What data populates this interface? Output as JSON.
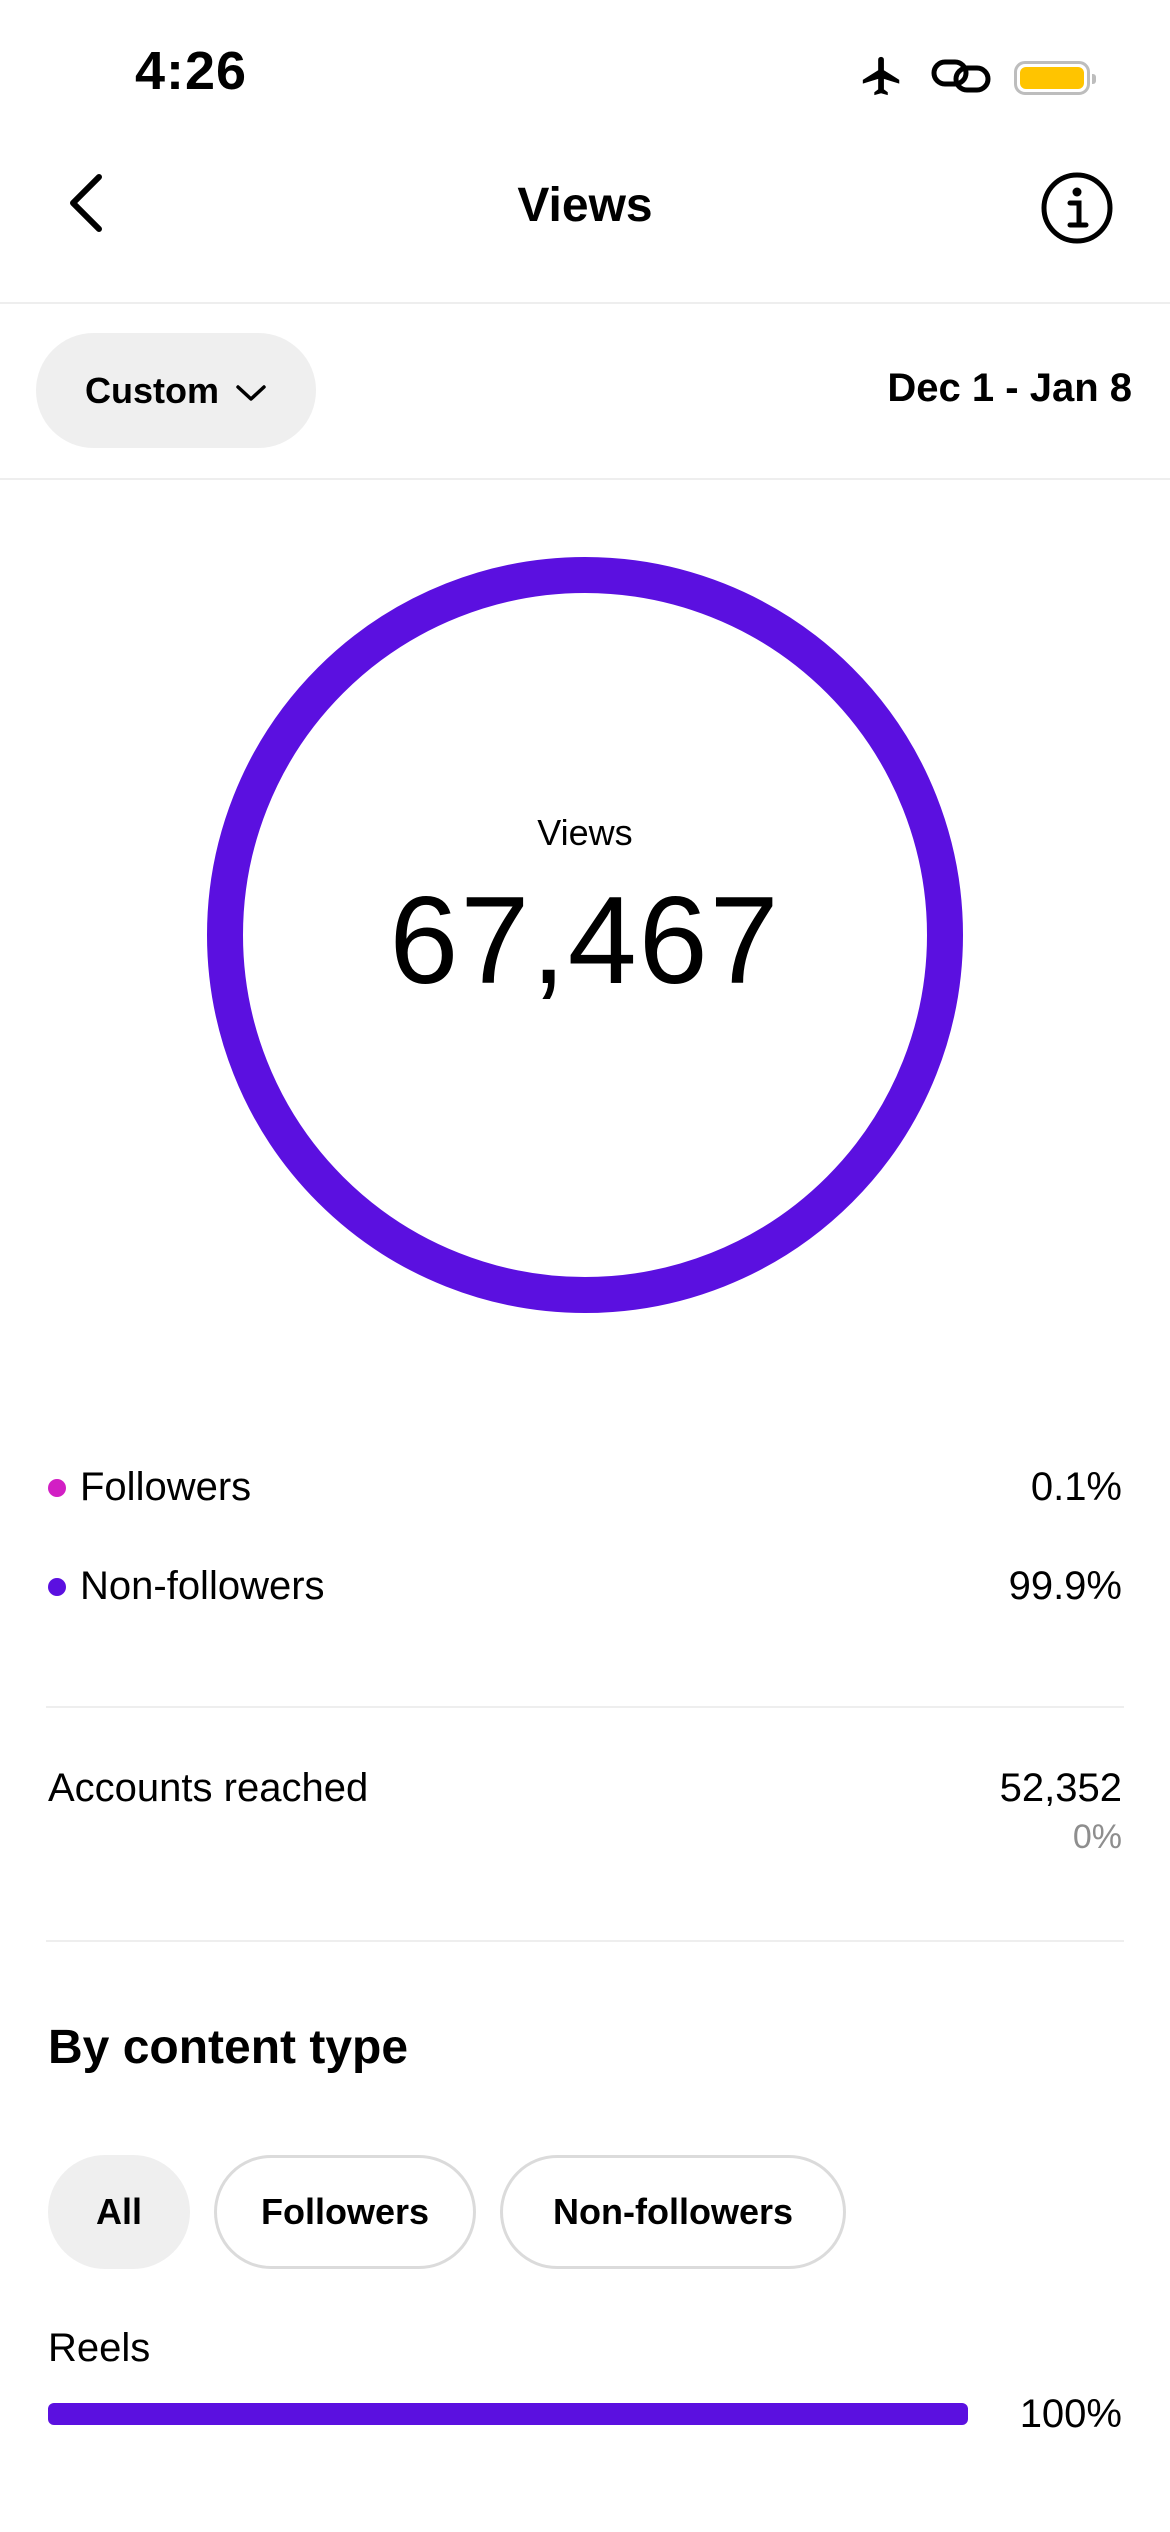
{
  "status_bar": {
    "time": "4:26",
    "icons": [
      "airplane-icon",
      "link-icon",
      "battery-icon"
    ],
    "battery_color": "#ffc400"
  },
  "nav": {
    "title": "Views",
    "back_icon": "chevron-left-icon",
    "info_icon": "info-icon"
  },
  "filter": {
    "range_label": "Custom",
    "date_range": "Dec 1 - Jan 8"
  },
  "summary": {
    "label": "Views",
    "value": "67,467",
    "ring_color": "#5b10e0"
  },
  "audience": [
    {
      "label": "Followers",
      "value": "0.1%",
      "color": "#d21fc4"
    },
    {
      "label": "Non-followers",
      "value": "99.9%",
      "color": "#5b10e0"
    }
  ],
  "accounts_reached": {
    "label": "Accounts reached",
    "value": "52,352",
    "change": "0%"
  },
  "content_type": {
    "title": "By content type",
    "chips": [
      "All",
      "Followers",
      "Non-followers"
    ],
    "selected_chip": "All",
    "rows": [
      {
        "label": "Reels",
        "value": "100%",
        "fraction": 1.0,
        "color": "#5b10e0"
      }
    ]
  }
}
